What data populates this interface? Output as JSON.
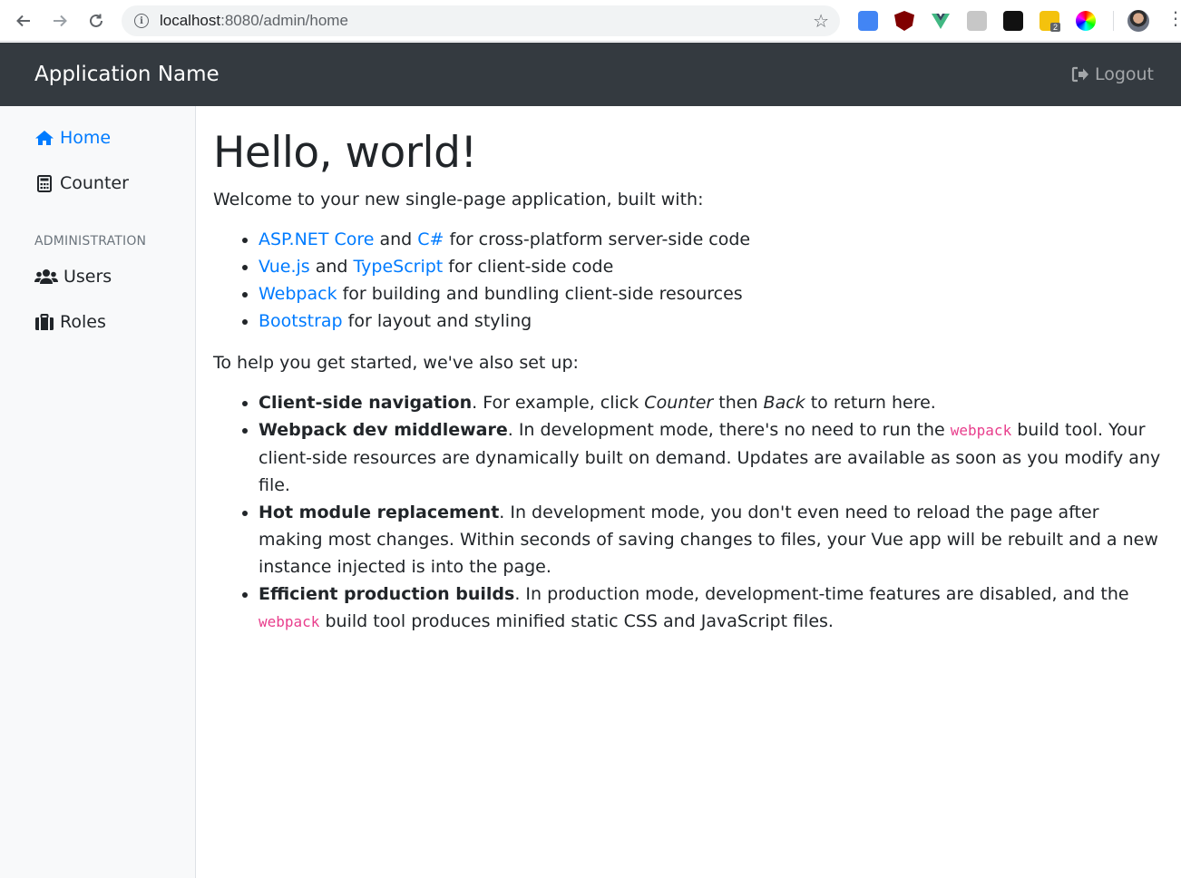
{
  "browser": {
    "url_host": "localhost",
    "url_path": ":8080/admin/home"
  },
  "app": {
    "brand": "Application Name",
    "logout_label": "Logout"
  },
  "sidebar": {
    "items": [
      {
        "label": "Home",
        "icon": "home-icon"
      },
      {
        "label": "Counter",
        "icon": "calculator-icon"
      }
    ],
    "section_heading": "ADMINISTRATION",
    "admin_items": [
      {
        "label": "Users",
        "icon": "users-icon"
      },
      {
        "label": "Roles",
        "icon": "briefcase-icon"
      }
    ]
  },
  "content": {
    "title": "Hello, world!",
    "intro": "Welcome to your new single-page application, built with:",
    "built_with": [
      {
        "link1": "ASP.NET Core",
        "mid": " and ",
        "link2": "C#",
        "rest": " for cross-platform server-side code"
      },
      {
        "link1": "Vue.js",
        "mid": " and ",
        "link2": "TypeScript",
        "rest": " for client-side code"
      },
      {
        "link1": "Webpack",
        "rest": " for building and bundling client-side resources"
      },
      {
        "link1": "Bootstrap",
        "rest": " for layout and styling"
      }
    ],
    "setup_intro": "To help you get started, we've also set up:",
    "setup": [
      {
        "bold": "Client-side navigation",
        "t1": ". For example, click ",
        "em1": "Counter",
        "t2": " then ",
        "em2": "Back",
        "t3": " to return here."
      },
      {
        "bold": "Webpack dev middleware",
        "t1": ". In development mode, there's no need to run the ",
        "code": "webpack",
        "t2": " build tool. Your client-side resources are dynamically built on demand. Updates are available as soon as you modify any file."
      },
      {
        "bold": "Hot module replacement",
        "t1": ". In development mode, you don't even need to reload the page after making most changes. Within seconds of saving changes to files, your Vue app will be rebuilt and a new instance injected is into the page."
      },
      {
        "bold": "Efficient production builds",
        "t1": ". In production mode, development-time features are disabled, and the ",
        "code": "webpack",
        "t2": " build tool produces minified static CSS and JavaScript files."
      }
    ]
  },
  "colors": {
    "navbar": "#343a40",
    "link": "#007bff",
    "code": "#e83e8c",
    "sidebar_bg": "#f8f9fa"
  }
}
